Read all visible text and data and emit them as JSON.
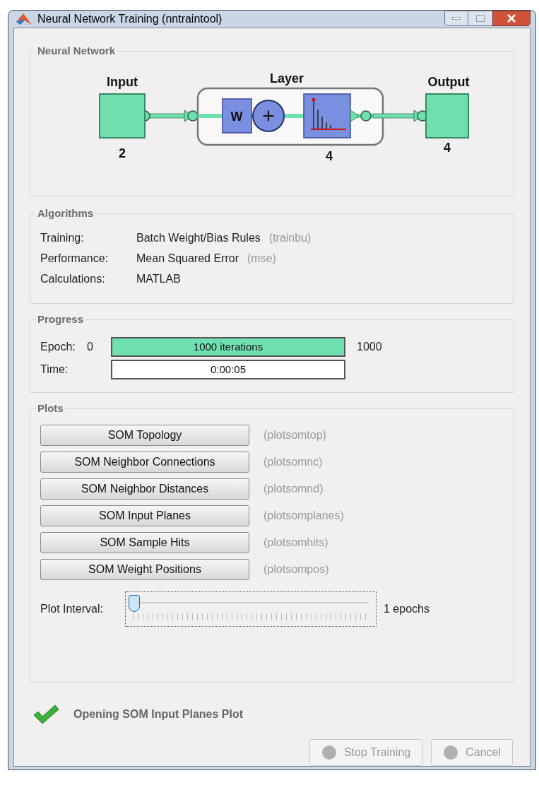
{
  "window": {
    "title": "Neural Network Training (nntraintool)"
  },
  "network": {
    "title": "Neural Network",
    "input": {
      "label": "Input",
      "size": "2"
    },
    "layer": {
      "label": "Layer",
      "size": "4"
    },
    "output": {
      "label": "Output",
      "size": "4"
    },
    "weight_symbol": "W",
    "sum_symbol": "+"
  },
  "algorithms": {
    "title": "Algorithms",
    "rows": [
      {
        "label": "Training:",
        "value": "Batch Weight/Bias Rules",
        "code": "(trainbu)"
      },
      {
        "label": "Performance:",
        "value": "Mean Squared Error",
        "code": "(mse)"
      },
      {
        "label": "Calculations:",
        "value": "MATLAB"
      }
    ]
  },
  "progress": {
    "title": "Progress",
    "epoch": {
      "label": "Epoch:",
      "start": "0",
      "text": "1000 iterations",
      "end": "1000",
      "level": 1
    },
    "time": {
      "label": "Time:",
      "text": "0:00:05"
    }
  },
  "plots": {
    "title": "Plots",
    "buttons": [
      {
        "label": "SOM Topology",
        "code": "(plotsomtop)"
      },
      {
        "label": "SOM Neighbor Connections",
        "code": "(plotsomnc)"
      },
      {
        "label": "SOM Neighbor Distances",
        "code": "(plotsomnd)"
      },
      {
        "label": "SOM Input Planes",
        "code": "(plotsomplanes)"
      },
      {
        "label": "SOM Sample Hits",
        "code": "(plotsomhits)"
      },
      {
        "label": "SOM Weight Positions",
        "code": "(plotsompos)"
      }
    ],
    "interval": {
      "label": "Plot Interval:",
      "level": 0,
      "reading": "1 epochs"
    }
  },
  "status": {
    "text": "Opening SOM Input Planes Plot"
  },
  "buttons": [
    {
      "label": "Stop Training",
      "disabled": true
    },
    {
      "label": "Cancel",
      "disabled": true
    }
  ]
}
